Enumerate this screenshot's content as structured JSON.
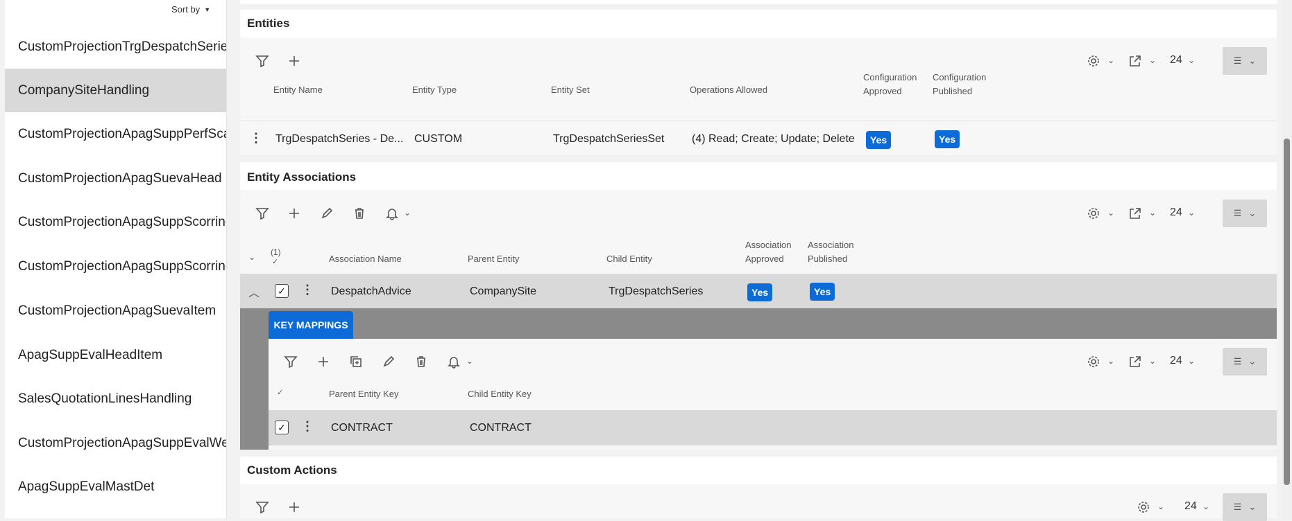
{
  "left_list": {
    "sort_label": "Sort by",
    "items": [
      "CustomProjectionTrgDespatchSeries",
      "CompanySiteHandling",
      "CustomProjectionApagSuppPerfScale",
      "CustomProjectionApagSuevaHead",
      "CustomProjectionApagSuppScorringl",
      "CustomProjectionApagSuppScorring",
      "CustomProjectionApagSuevaItem",
      "ApagSuppEvalHeadItem",
      "SalesQuotationLinesHandling",
      "CustomProjectionApagSuppEvalWeig",
      "ApagSuppEvalMastDet"
    ],
    "selected_index": 1
  },
  "entities": {
    "title": "Entities",
    "page_size": "24",
    "headers": {
      "entity_name": "Entity Name",
      "entity_type": "Entity Type",
      "entity_set": "Entity Set",
      "operations_allowed": "Operations Allowed",
      "config_approved": "Configuration Approved",
      "config_published": "Configuration Published"
    },
    "row": {
      "entity_name": "TrgDespatchSeries - De...",
      "entity_type": "CUSTOM",
      "entity_set": "TrgDespatchSeriesSet",
      "operations_allowed": "(4) Read; Create; Update; Delete",
      "config_approved": "Yes",
      "config_published": "Yes"
    }
  },
  "entity_associations": {
    "title": "Entity Associations",
    "page_size": "24",
    "selected_count": "(1)",
    "headers": {
      "association_name": "Association Name",
      "parent_entity": "Parent Entity",
      "child_entity": "Child Entity",
      "association_approved": "Association Approved",
      "association_published": "Association Published"
    },
    "row": {
      "association_name": "DespatchAdvice",
      "parent_entity": "CompanySite",
      "child_entity": "TrgDespatchSeries",
      "association_approved": "Yes",
      "association_published": "Yes"
    }
  },
  "key_mappings": {
    "tab_label": "KEY MAPPINGS",
    "page_size": "24",
    "headers": {
      "parent_entity_key": "Parent Entity Key",
      "child_entity_key": "Child Entity Key"
    },
    "row": {
      "parent_entity_key": "CONTRACT",
      "child_entity_key": "CONTRACT"
    }
  },
  "custom_actions": {
    "title": "Custom Actions",
    "page_size": "24"
  },
  "colors": {
    "accent": "#0c6bd6",
    "selected_row": "#d9d9d9",
    "detail_band": "#8a8a8a"
  }
}
